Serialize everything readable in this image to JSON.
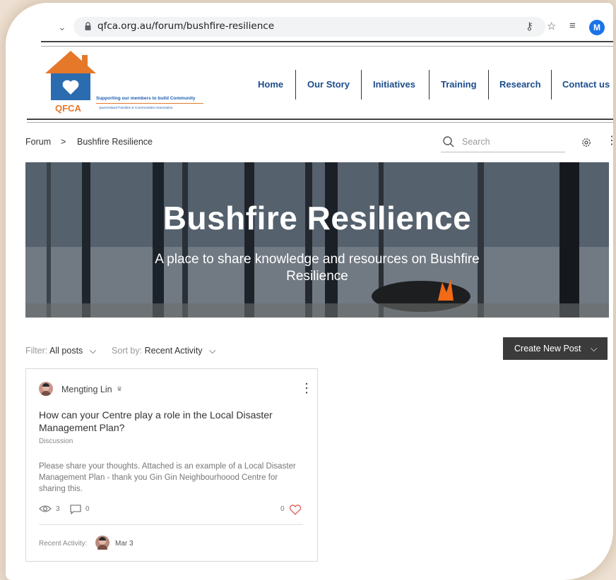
{
  "browser": {
    "url": "qfca.org.au/forum/bushfire-resilience",
    "profile_initial": "M"
  },
  "logo": {
    "name": "QFCA",
    "tagline": "Supporting our members to build Community",
    "subtagline": "Queensland Families & Communities Association"
  },
  "nav": {
    "items": [
      "Home",
      "Our Story",
      "Initiatives",
      "Training",
      "Research",
      "Contact us"
    ]
  },
  "breadcrumb": {
    "root": "Forum",
    "separator": ">",
    "current": "Bushfire Resilience"
  },
  "search": {
    "placeholder": "Search"
  },
  "banner": {
    "title": "Bushfire Resilience",
    "subtitle": "A place to share knowledge and resources on Bushfire Resilience"
  },
  "filters": {
    "filter_label": "Filter:",
    "filter_value": "All posts",
    "sort_label": "Sort by:",
    "sort_value": "Recent Activity"
  },
  "create_button": "Create New Post",
  "post": {
    "author": "Mengting Lin",
    "title": "How can your Centre play a role in the Local Disaster Management Plan?",
    "category": "Discussion",
    "body": "Please share your thoughts. Attached is an example of a Local Disaster Management Plan - thank you Gin Gin Neighbourhoood Centre for sharing this.",
    "views": "3",
    "comments": "0",
    "likes": "0",
    "recent_label": "Recent Activity:",
    "recent_date": "Mar 3"
  },
  "colors": {
    "nav_text": "#1c4d8c",
    "logo_orange": "#e6782a",
    "logo_blue": "#2b6cb0",
    "button_bg": "#3b3b3b",
    "heart": "#e05a5a"
  }
}
